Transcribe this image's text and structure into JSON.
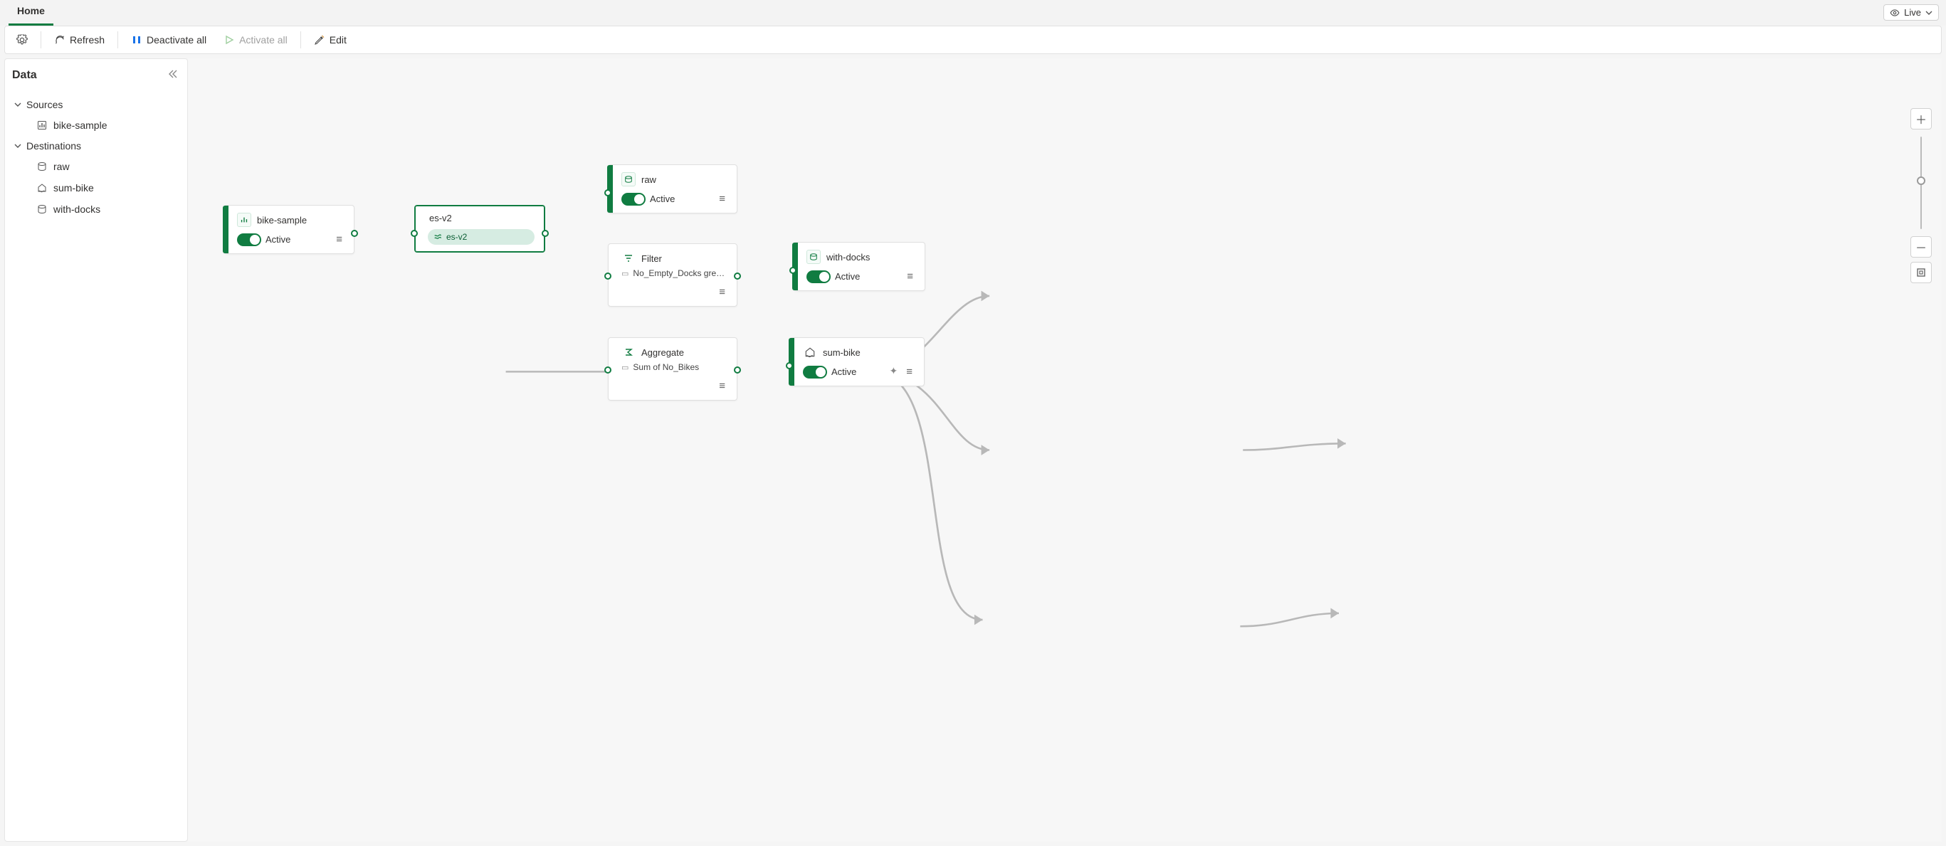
{
  "tabs": {
    "home": "Home"
  },
  "live": {
    "label": "Live"
  },
  "toolbar": {
    "settings": "",
    "refresh": "Refresh",
    "deactivate": "Deactivate all",
    "activate": "Activate all",
    "edit": "Edit"
  },
  "sidebar": {
    "title": "Data",
    "sections": {
      "sources": {
        "label": "Sources",
        "items": [
          {
            "name": "bike-sample"
          }
        ]
      },
      "destinations": {
        "label": "Destinations",
        "items": [
          {
            "name": "raw"
          },
          {
            "name": "sum-bike"
          },
          {
            "name": "with-docks"
          }
        ]
      }
    }
  },
  "nodes": {
    "bikesample": {
      "title": "bike-sample",
      "status": "Active"
    },
    "esv2": {
      "title": "es-v2",
      "chip": "es-v2"
    },
    "raw": {
      "title": "raw",
      "status": "Active"
    },
    "filter": {
      "title": "Filter",
      "detail": "No_Empty_Docks greater t..."
    },
    "aggregate": {
      "title": "Aggregate",
      "detail": "Sum of No_Bikes"
    },
    "withdocks": {
      "title": "with-docks",
      "status": "Active"
    },
    "sumbike": {
      "title": "sum-bike",
      "status": "Active"
    }
  }
}
